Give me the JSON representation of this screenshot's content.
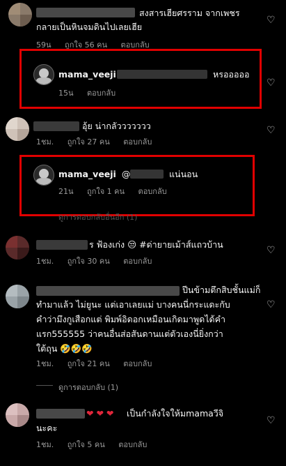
{
  "comments": [
    {
      "text": "สงสารเฮียศรราม จากเพชร",
      "text2": "กลายเป็นหินจมดินไปเลยเฮีย",
      "time": "59น",
      "likes": "ถูกใจ 56 คน",
      "reply": "ตอบกลับ"
    },
    {
      "user": "mama_veeji",
      "text": "หรอออออ",
      "time": "15น",
      "reply": "ตอบกลับ"
    },
    {
      "text": "อุ้ย น่ากลัววววววว",
      "time": "1ชม.",
      "likes": "ถูกใจ 27 คน",
      "reply": "ตอบกลับ"
    },
    {
      "user": "mama_veeji",
      "mention": "@",
      "text": "แน่นอน",
      "time": "21น",
      "likes": "ถูกใจ 1 คน",
      "reply": "ตอบกลับ"
    },
    {
      "text": "ร ฟ้องเก่ง 😒 #ด่ายายเม้าส์แถวบ้าน",
      "time": "1ชม.",
      "likes": "ถูกใจ 30 คน",
      "reply": "ตอบกลับ"
    },
    {
      "line1": "ปีนข้ามตึกสิบชั้นแม่ก็",
      "line2": "ทำมาแล้ว ไม่ยูนะ แต่เอาเลยแม่ บางคนนี่กระแดะกับ",
      "line3": "คำว่ามึงกูเสือกแต่ พิมพ์อิดอกเหมือนเกิดมาพูดได้คำ",
      "line4": "แรก555555 ว่าคนอื่นส่อสันดานแต่ตัวเองนี่ยิ่งกว่า",
      "line5": "ใต้ถุน 🤣🤣🤣",
      "time": "1ชม.",
      "likes": "ถูกใจ 21 คน",
      "reply": "ตอบกลับ"
    },
    {
      "text": "เป็นกำลังใจให้มmamaวีจิ",
      "text2": "นะคะ",
      "time": "1ชม.",
      "likes": "ถูกใจ 5 คน",
      "reply": "ตอบกลับ"
    }
  ],
  "partial_view_replies": "ดูการตอบกลับอื่นอีก (1)",
  "view_replies": "ดูการตอบกลับ (1)",
  "colors": {
    "highlight": "#e10000",
    "background": "#000000"
  },
  "icons": {
    "like": "heart-outline-icon"
  }
}
